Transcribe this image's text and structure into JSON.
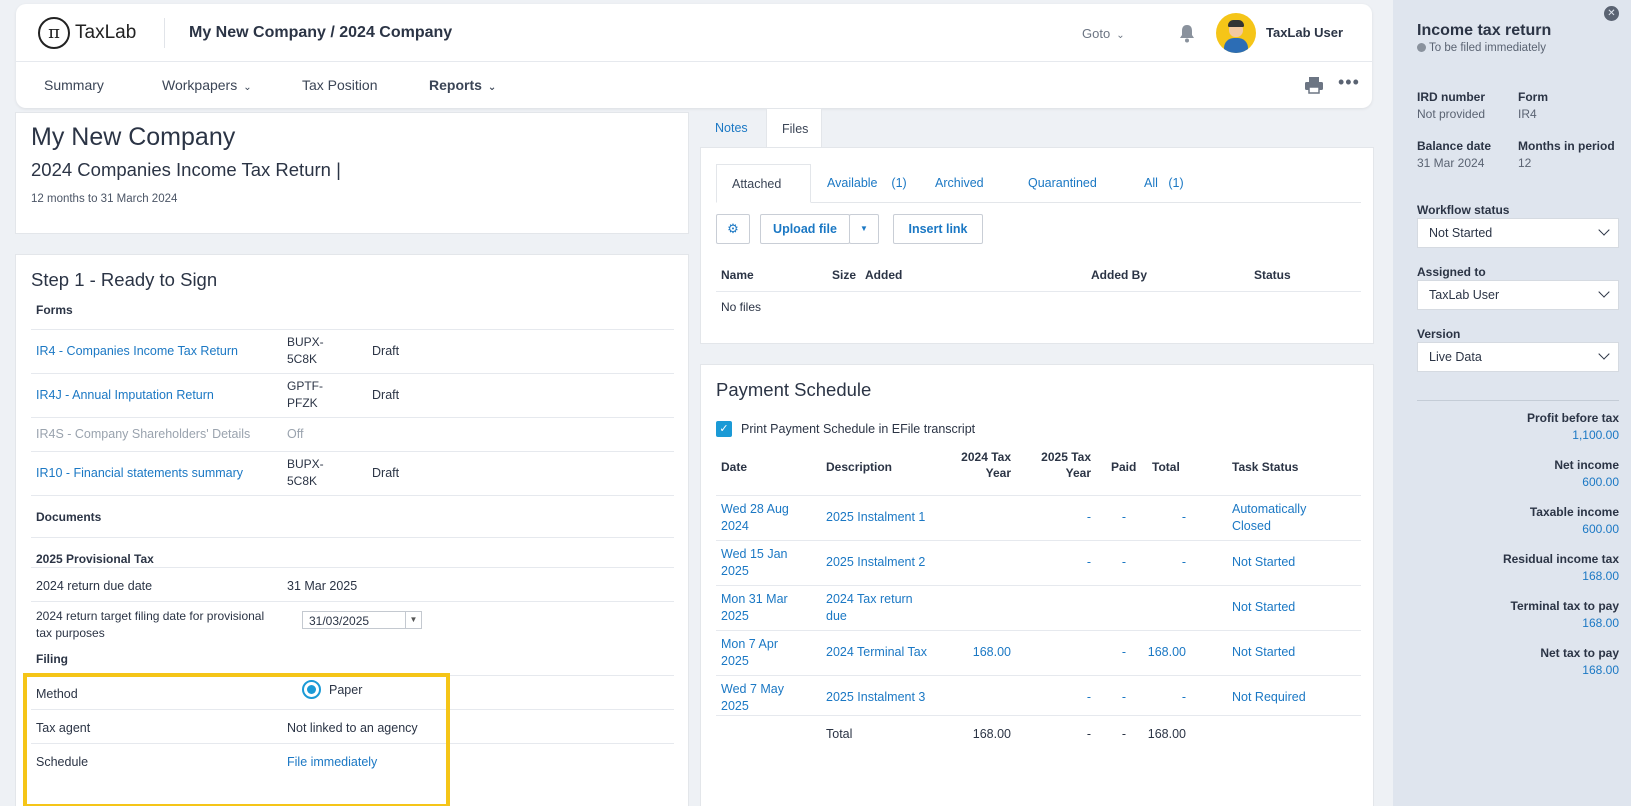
{
  "app": {
    "logo_text": "TaxLab",
    "breadcrumb": "My New Company / 2024 Company",
    "goto_label": "Goto",
    "user_name": "TaxLab User"
  },
  "nav": {
    "summary": "Summary",
    "workpapers": "Workpapers",
    "tax_position": "Tax Position",
    "reports": "Reports"
  },
  "header": {
    "company": "My New Company",
    "return_title": "2024 Companies Income Tax Return |",
    "period": "12 months to 31 March 2024"
  },
  "step": {
    "title": "Step 1 - Ready to Sign",
    "forms_heading": "Forms",
    "forms": [
      {
        "name": "IR4 - Companies Income Tax Return",
        "code": "BUPX-\n5C8K",
        "status": "Draft"
      },
      {
        "name": "IR4J - Annual Imputation Return",
        "code": "GPTF-\nPFZK",
        "status": "Draft"
      },
      {
        "name": "IR4S - Company Shareholders' Details",
        "code": "Off",
        "status": ""
      },
      {
        "name": "IR10 - Financial statements summary",
        "code": "BUPX-\n5C8K",
        "status": "Draft"
      }
    ],
    "documents_heading": "Documents",
    "provisional_heading": "2025 Provisional Tax",
    "due_date_label": "2024 return due date",
    "due_date_value": "31 Mar 2025",
    "target_label": "2024 return target filing date for provisional tax purposes",
    "target_value": "31/03/2025",
    "filing_heading": "Filing",
    "method_label": "Method",
    "method_value": "Paper",
    "agent_label": "Tax agent",
    "agent_value": "Not linked to an agency",
    "schedule_label": "Schedule",
    "schedule_value": "File immediately"
  },
  "files": {
    "tabs": [
      "Notes",
      "Files"
    ],
    "subtabs": {
      "attached": "Attached",
      "available": "Available",
      "available_count": "(1)",
      "archived": "Archived",
      "quarantined": "Quarantined",
      "all": "All",
      "all_count": "(1)"
    },
    "upload_label": "Upload file",
    "insert_link_label": "Insert link",
    "columns": [
      "Name",
      "Size",
      "Added",
      "Added By",
      "Status"
    ],
    "empty_text": "No files"
  },
  "payment": {
    "title": "Payment Schedule",
    "checkbox_label": "Print Payment Schedule in EFile transcript",
    "columns": {
      "date": "Date",
      "description": "Description",
      "y2024": "2024 Tax\nYear",
      "y2025": "2025 Tax\nYear",
      "paid": "Paid",
      "total": "Total",
      "task": "Task Status"
    },
    "rows": [
      {
        "date": "Wed 28 Aug\n2024",
        "desc": "2025 Instalment 1",
        "y2024": "",
        "y2025": "-",
        "paid": "-",
        "total": "-",
        "task": "Automatically\nClosed"
      },
      {
        "date": "Wed 15 Jan\n2025",
        "desc": "2025 Instalment 2",
        "y2024": "",
        "y2025": "-",
        "paid": "-",
        "total": "-",
        "task": "Not Started"
      },
      {
        "date": "Mon 31 Mar\n2025",
        "desc": "2024 Tax return\ndue",
        "y2024": "",
        "y2025": "",
        "paid": "",
        "total": "",
        "task": "Not Started"
      },
      {
        "date": "Mon 7 Apr\n2025",
        "desc": "2024 Terminal Tax",
        "y2024": "168.00",
        "y2025": "",
        "paid": "-",
        "total": "168.00",
        "task": "Not Started"
      },
      {
        "date": "Wed 7 May\n2025",
        "desc": "2025 Instalment 3",
        "y2024": "",
        "y2025": "-",
        "paid": "-",
        "total": "-",
        "task": "Not Required"
      }
    ],
    "total_row": {
      "label": "Total",
      "y2024": "168.00",
      "y2025": "-",
      "paid": "-",
      "total": "168.00"
    }
  },
  "side": {
    "title": "Income tax return",
    "subtitle": "To be filed immediately",
    "ird_label": "IRD number",
    "ird_value": "Not provided",
    "form_label": "Form",
    "form_value": "IR4",
    "balance_label": "Balance date",
    "balance_value": "31 Mar 2024",
    "months_label": "Months in period",
    "months_value": "12",
    "workflow_label": "Workflow status",
    "workflow_value": "Not Started",
    "assigned_label": "Assigned to",
    "assigned_value": "TaxLab User",
    "version_label": "Version",
    "version_value": "Live Data",
    "summary": [
      {
        "label": "Profit before tax",
        "value": "1,100.00"
      },
      {
        "label": "Net income",
        "value": "600.00"
      },
      {
        "label": "Taxable income",
        "value": "600.00"
      },
      {
        "label": "Residual income tax",
        "value": "168.00"
      },
      {
        "label": "Terminal tax to pay",
        "value": "168.00"
      },
      {
        "label": "Net tax to pay",
        "value": "168.00"
      }
    ]
  }
}
